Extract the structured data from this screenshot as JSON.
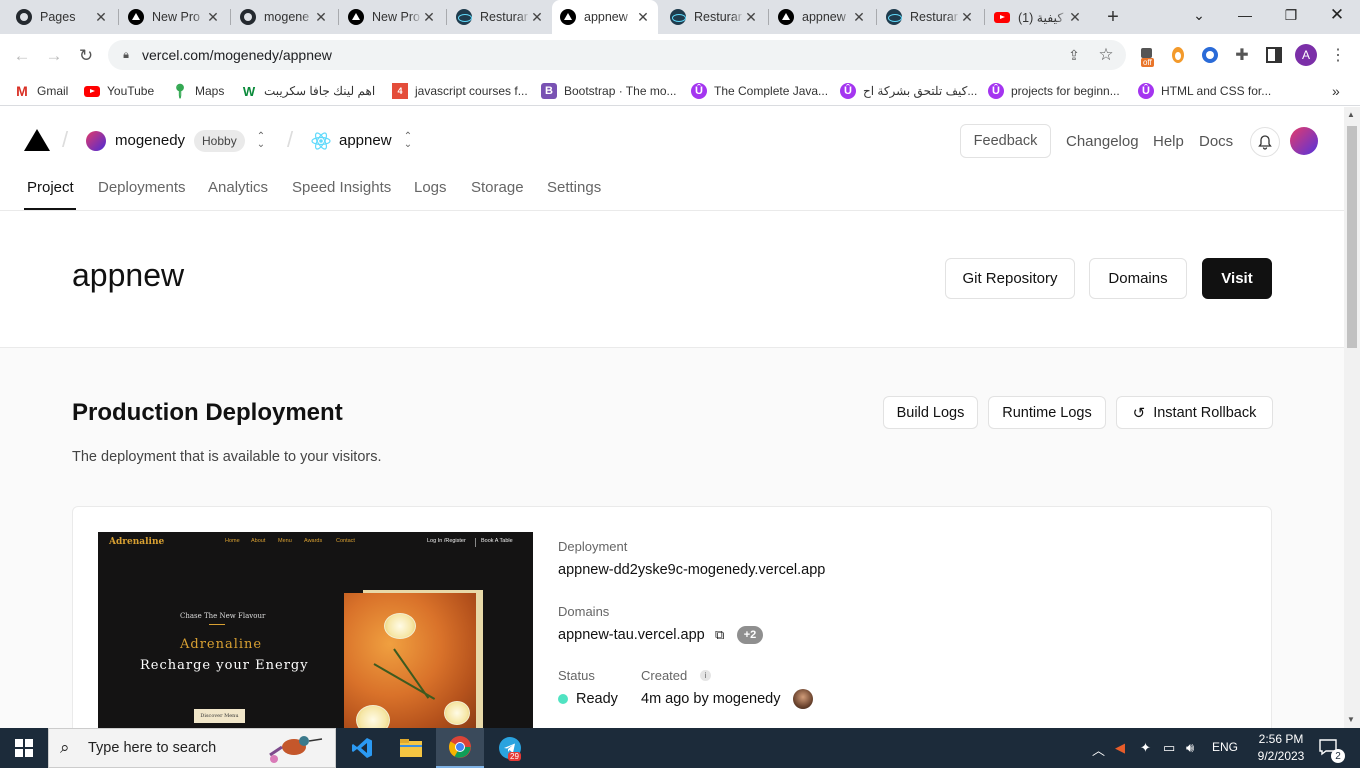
{
  "browser": {
    "tabs": [
      {
        "title": "Pages",
        "icon": "github-icon"
      },
      {
        "title": "New Pro",
        "icon": "vercel-icon"
      },
      {
        "title": "mogene",
        "icon": "github-icon"
      },
      {
        "title": "New Pro",
        "icon": "vercel-icon"
      },
      {
        "title": "Resturar",
        "icon": "react-icon"
      },
      {
        "title": "appnew",
        "icon": "vercel-icon",
        "active": true
      },
      {
        "title": "Resturar",
        "icon": "react-icon"
      },
      {
        "title": "appnew",
        "icon": "vercel-icon"
      },
      {
        "title": "Resturar",
        "icon": "react-icon"
      },
      {
        "title": "(1) كيفية",
        "icon": "youtube-icon"
      }
    ],
    "new_tab": "+",
    "url": "vercel.com/mogenedy/appnew",
    "extension_badge": "off",
    "profile_initial": "A",
    "bookmarks": [
      {
        "label": "Gmail",
        "icon": "gmail-icon"
      },
      {
        "label": "YouTube",
        "icon": "youtube-icon"
      },
      {
        "label": "Maps",
        "icon": "maps-icon"
      },
      {
        "label": "اهم لينك جافا سكريبت",
        "icon": "w3schools-icon"
      },
      {
        "label": "javascript courses f...",
        "icon": "bookmark-icon"
      },
      {
        "label": "Bootstrap · The mo...",
        "icon": "bootstrap-icon"
      },
      {
        "label": "The Complete Java...",
        "icon": "udemy-icon"
      },
      {
        "label": "كيف تلتحق بشركة اح...",
        "icon": "udemy-icon"
      },
      {
        "label": "projects for beginn...",
        "icon": "udemy-icon"
      },
      {
        "label": "HTML and CSS for...",
        "icon": "udemy-icon"
      }
    ],
    "more_bookmarks": "»"
  },
  "header": {
    "team_name": "mogenedy",
    "plan_badge": "Hobby",
    "project_name": "appnew",
    "feedback_label": "Feedback",
    "links": [
      "Changelog",
      "Help",
      "Docs"
    ]
  },
  "project_tabs": [
    "Project",
    "Deployments",
    "Analytics",
    "Speed Insights",
    "Logs",
    "Storage",
    "Settings"
  ],
  "project": {
    "title": "appnew",
    "git_button": "Git Repository",
    "domains_button": "Domains",
    "visit_button": "Visit"
  },
  "production": {
    "title": "Production Deployment",
    "description": "The deployment that is available to your visitors.",
    "build_logs": "Build Logs",
    "runtime_logs": "Runtime Logs",
    "rollback": "Instant Rollback",
    "deployment_label": "Deployment",
    "deployment_url": "appnew-dd2yske9c-mogenedy.vercel.app",
    "domains_label": "Domains",
    "domain_url": "appnew-tau.vercel.app",
    "extra_domains": "+2",
    "status_label": "Status",
    "status_value": "Ready",
    "status_color": "#50e3c2",
    "created_label": "Created",
    "created_value": "4m ago by mogenedy"
  },
  "preview": {
    "brand": "Adrenaline",
    "nav": [
      "Home",
      "About",
      "Menu",
      "Awards",
      "Contact"
    ],
    "login": "Log In /Register",
    "book": "Book A Table",
    "chase": "Chase The New Flavour",
    "hero_brand": "Adrenaline",
    "tagline": "Recharge your Energy",
    "cta": "Discover Menu"
  },
  "taskbar": {
    "search_placeholder": "Type here to search",
    "telegram_badge": "29",
    "language": "ENG",
    "time": "2:56 PM",
    "date": "9/2/2023",
    "notifications": "2"
  }
}
